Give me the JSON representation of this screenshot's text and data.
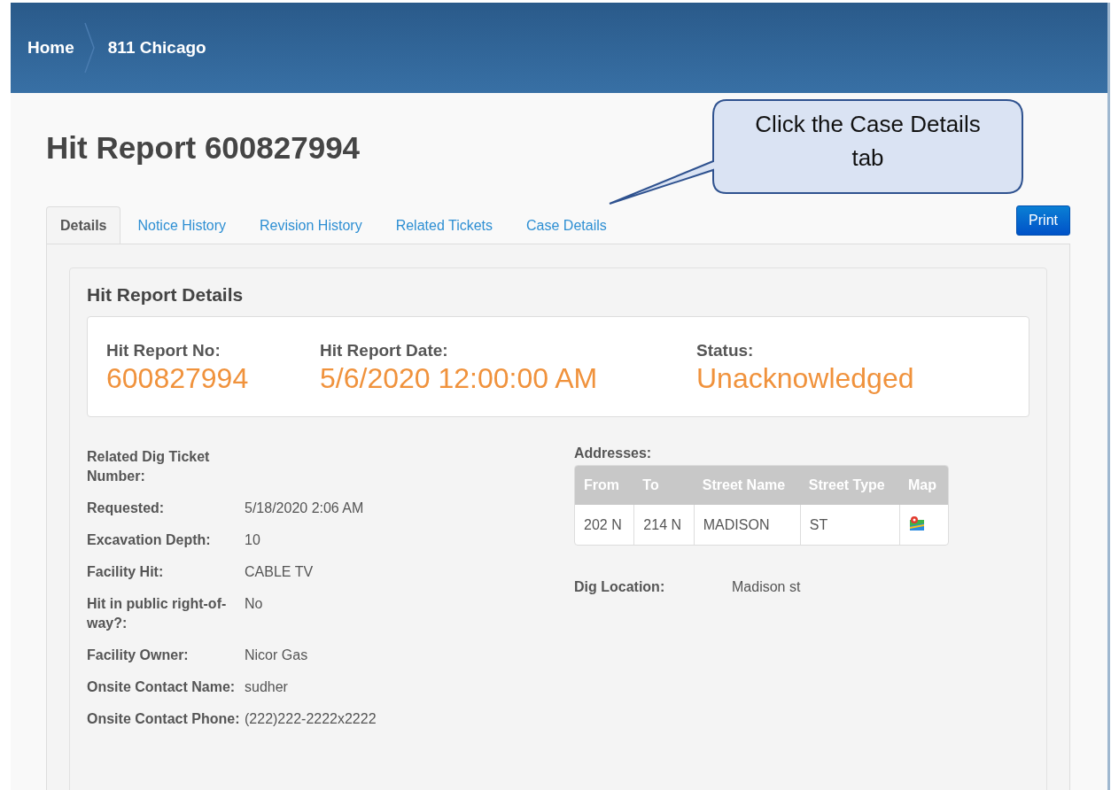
{
  "breadcrumbs": [
    {
      "label": "Home"
    },
    {
      "label": "811 Chicago"
    }
  ],
  "title": "Hit Report 600827994",
  "tabs": [
    {
      "label": "Details",
      "selected": true
    },
    {
      "label": "Notice History",
      "selected": false
    },
    {
      "label": "Revision History",
      "selected": false
    },
    {
      "label": "Related Tickets",
      "selected": false
    },
    {
      "label": "Case Details",
      "selected": false
    }
  ],
  "print_button": "Print",
  "callout": "Click the Case Details tab",
  "section_title": "Hit Report Details",
  "summary": [
    {
      "label": "Hit Report No:",
      "value": "600827994"
    },
    {
      "label": "Hit Report Date:",
      "value": "5/6/2020 12:00:00 AM"
    },
    {
      "label": "Status:",
      "value": "Unacknowledged"
    }
  ],
  "details": [
    {
      "label": "Related Dig Ticket Number:"
    },
    {
      "label": "Requested:",
      "value": "5/18/2020 2:06 AM"
    },
    {
      "label": "Excavation Depth:",
      "value": "10"
    },
    {
      "label": "Facility Hit:",
      "value": "CABLE TV"
    },
    {
      "label": "Hit in public right-of-way?:",
      "value": "No"
    },
    {
      "label": "Facility Owner:",
      "value": "Nicor Gas"
    },
    {
      "label": "Onsite Contact Name:",
      "value": "sudher"
    },
    {
      "label": "Onsite Contact Phone:",
      "value": "(222)222-2222x2222"
    }
  ],
  "addresses": {
    "label": "Addresses:",
    "columns": [
      "From",
      "To",
      "Street Name",
      "Street Type",
      "Map"
    ],
    "rows": [
      {
        "cells": [
          "202 N",
          "214 N",
          "MADISON",
          "ST"
        ],
        "map": true
      }
    ]
  },
  "dig_location": {
    "label": "Dig Location:",
    "value": "Madison st"
  }
}
